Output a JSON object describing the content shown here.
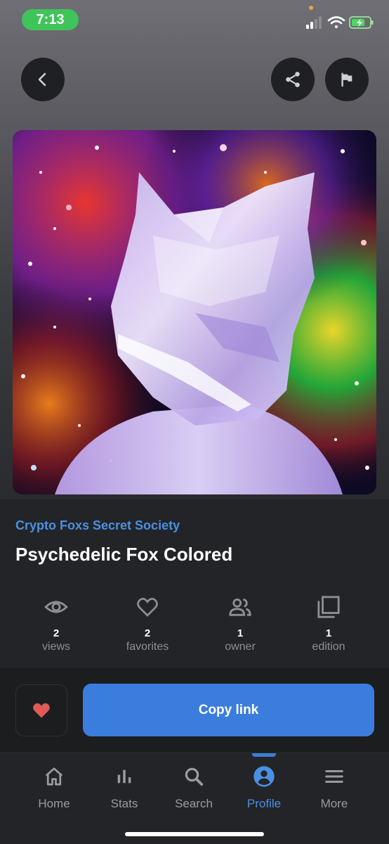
{
  "status_bar": {
    "time": "7:13"
  },
  "header": {
    "back_icon": "chevron-left-icon",
    "share_icon": "share-icon",
    "report_icon": "flag-icon"
  },
  "nft": {
    "collection": "Crypto Foxs Secret Society",
    "title": "Psychedelic Fox Colored"
  },
  "stats": [
    {
      "icon": "eye-icon",
      "value": "2",
      "label": "views"
    },
    {
      "icon": "heart-outline-icon",
      "value": "2",
      "label": "favorites"
    },
    {
      "icon": "people-icon",
      "value": "1",
      "label": "owner"
    },
    {
      "icon": "copies-icon",
      "value": "1",
      "label": "edition"
    }
  ],
  "actions": {
    "favorite_icon": "heart-icon",
    "copy_link_label": "Copy link"
  },
  "tabbar": {
    "items": [
      {
        "icon": "home-icon",
        "label": "Home"
      },
      {
        "icon": "bar-chart-icon",
        "label": "Stats"
      },
      {
        "icon": "search-icon",
        "label": "Search"
      },
      {
        "icon": "profile-icon",
        "label": "Profile",
        "active": true
      },
      {
        "icon": "menu-icon",
        "label": "More"
      }
    ]
  },
  "colors": {
    "accent": "#3b7ddd",
    "link": "#4a90e2",
    "favorite": "#e05a5a",
    "time_pill": "#3fc45a"
  }
}
